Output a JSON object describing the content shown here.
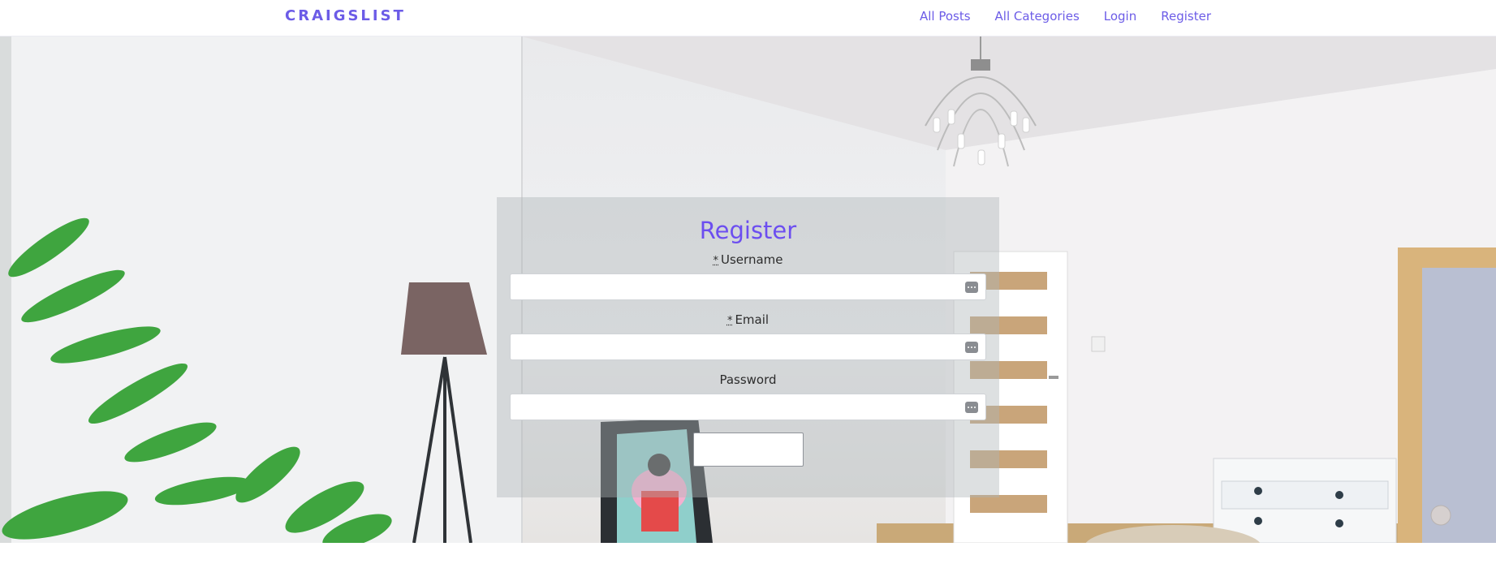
{
  "nav": {
    "brand": "CRAIGSLIST",
    "links": [
      "All Posts",
      "All Categories",
      "Login",
      "Register"
    ]
  },
  "form": {
    "title": "Register",
    "required_marker": "*",
    "fields": [
      {
        "label": "Username",
        "required": true,
        "value": ""
      },
      {
        "label": "Email",
        "required": true,
        "value": ""
      },
      {
        "label": "Password",
        "required": false,
        "value": ""
      }
    ],
    "submit_label": ""
  },
  "colors": {
    "accent": "#6c5ce7",
    "title": "#6c4ef0",
    "panel": "#afb4b8"
  },
  "icons": {
    "field_icon": "keyboard-icon"
  }
}
